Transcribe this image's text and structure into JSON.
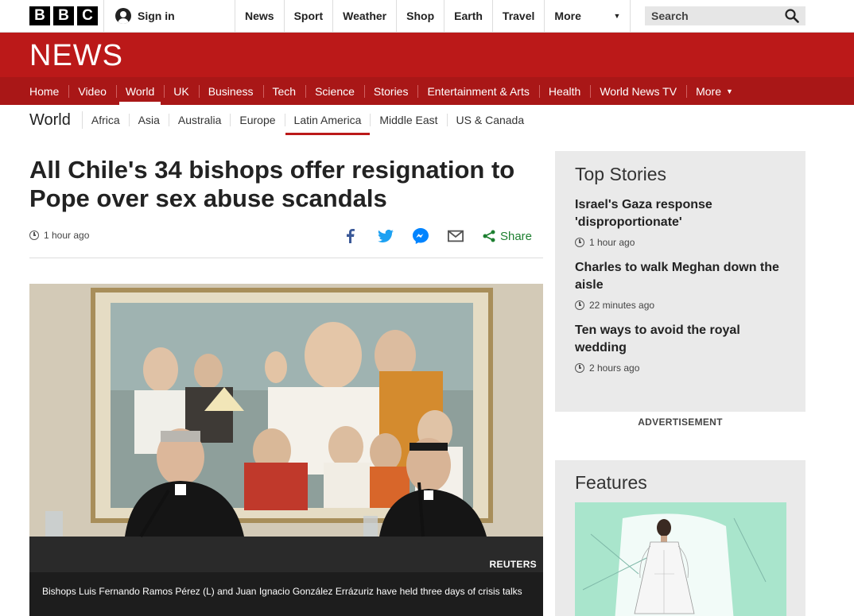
{
  "masthead": {
    "logo_letters": [
      "B",
      "B",
      "C"
    ],
    "signin_label": "Sign in",
    "nav": [
      "News",
      "Sport",
      "Weather",
      "Shop",
      "Earth",
      "Travel"
    ],
    "more_label": "More",
    "search_placeholder": "Search"
  },
  "newsbar": {
    "logo": "NEWS"
  },
  "main_nav": {
    "items": [
      "Home",
      "Video",
      "World",
      "UK",
      "Business",
      "Tech",
      "Science",
      "Stories",
      "Entertainment & Arts",
      "Health",
      "World News TV"
    ],
    "more_label": "More",
    "active": "World"
  },
  "section_nav": {
    "title": "World",
    "items": [
      "Africa",
      "Asia",
      "Australia",
      "Europe",
      "Latin America",
      "Middle East",
      "US & Canada"
    ],
    "active": "Latin America"
  },
  "article": {
    "headline": "All Chile's 34 bishops offer resignation to Pope over sex abuse scandals",
    "timestamp": "1 hour ago",
    "share_label": "Share",
    "share_icons": [
      "facebook-icon",
      "twitter-icon",
      "messenger-icon",
      "email-icon",
      "share-icon"
    ],
    "image_credit": "REUTERS",
    "image_caption": "Bishops Luis Fernando Ramos Pérez (L) and Juan Ignacio González Errázuriz have held three days of crisis talks"
  },
  "sidebar": {
    "top_stories_title": "Top Stories",
    "stories": [
      {
        "title": "Israel's Gaza response 'disproportionate'",
        "time": "1 hour ago"
      },
      {
        "title": "Charles to walk Meghan down the aisle",
        "time": "22 minutes ago"
      },
      {
        "title": "Ten ways to avoid the royal wedding",
        "time": "2 hours ago"
      }
    ],
    "advert_label": "ADVERTISEMENT",
    "features_title": "Features"
  },
  "colors": {
    "bbc_red": "#bb1919",
    "nav_red": "#a91717",
    "share_green": "#1d7f30",
    "panel_grey": "#eaeaea"
  }
}
